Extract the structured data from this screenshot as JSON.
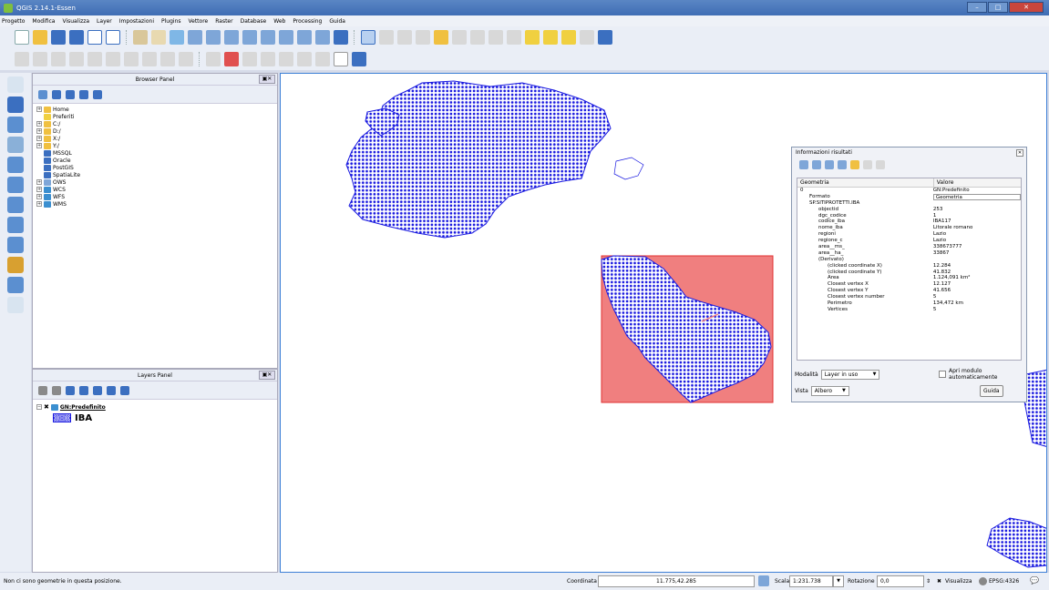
{
  "app": {
    "title": "QGIS 2.14.1-Essen"
  },
  "menu": [
    "Progetto",
    "Modifica",
    "Visualizza",
    "Layer",
    "Impostazioni",
    "Plugins",
    "Vettore",
    "Raster",
    "Database",
    "Web",
    "Processing",
    "Guida"
  ],
  "browser_panel": {
    "title": "Browser Panel",
    "items": [
      "Home",
      "Preferiti",
      "C:/",
      "D:/",
      "X:/",
      "Y:/",
      "MSSQL",
      "Oracle",
      "PostGIS",
      "SpatiaLite",
      "OWS",
      "WCS",
      "WFS",
      "WMS"
    ]
  },
  "layers_panel": {
    "title": "Layers Panel",
    "group": "GN:Predefinito",
    "layer": "IBA"
  },
  "identify_panel": {
    "title": "Informazioni risultati",
    "col_feature": "Geometria",
    "col_value": "Valore",
    "rows": [
      {
        "label": "0",
        "value": "GN:Predefinito",
        "indent": 0
      },
      {
        "label": "Formato",
        "value": "Geometria",
        "indent": 1
      },
      {
        "label": "SP.SITIPROTETTI.IBA",
        "value": "",
        "indent": 1
      },
      {
        "label": "objectid",
        "value": "253",
        "indent": 2
      },
      {
        "label": "dgc_codice",
        "value": "1",
        "indent": 2
      },
      {
        "label": "codice_iba",
        "value": "IBA117",
        "indent": 2
      },
      {
        "label": "nome_iba",
        "value": "Litorale romano",
        "indent": 2
      },
      {
        "label": "regioni",
        "value": "Lazio",
        "indent": 2
      },
      {
        "label": "regione_c",
        "value": "Lazio",
        "indent": 2
      },
      {
        "label": "area__ms_",
        "value": "338673777",
        "indent": 2
      },
      {
        "label": "area__ha_",
        "value": "33867",
        "indent": 2
      },
      {
        "label": "(Derivato)",
        "value": "",
        "indent": 2
      },
      {
        "label": "(clicked coordinate X)",
        "value": "12.284",
        "indent": 3
      },
      {
        "label": "(clicked coordinate Y)",
        "value": "41.832",
        "indent": 3
      },
      {
        "label": "Area",
        "value": "1.124,091 km²",
        "indent": 3
      },
      {
        "label": "Closest vertex X",
        "value": "12.127",
        "indent": 3
      },
      {
        "label": "Closest vertex Y",
        "value": "41.656",
        "indent": 3
      },
      {
        "label": "Closest vertex number",
        "value": "5",
        "indent": 3
      },
      {
        "label": "Perimetro",
        "value": "134,472 km",
        "indent": 3
      },
      {
        "label": "Vertices",
        "value": "5",
        "indent": 3
      }
    ],
    "mode_label": "Modalità",
    "mode_value": "Layer in uso",
    "auto_open_label": "Apri modulo automaticamente",
    "view_label": "Vista",
    "view_value": "Albero",
    "help_label": "Guida"
  },
  "status": {
    "message": "Non ci sono geometrie in questa posizione.",
    "coord_label": "Coordinata",
    "coord_value": "11.775,42.285",
    "scale_label": "Scala",
    "scale_value": "1:231.738",
    "rotation_label": "Rotazione",
    "rotation_value": "0,0",
    "render_label": "Visualizza",
    "crs": "EPSG:4326"
  },
  "colors": {
    "selection_fill": "#f08080",
    "selection_border": "#e03030",
    "feature_dots": "#1a1ae0"
  }
}
